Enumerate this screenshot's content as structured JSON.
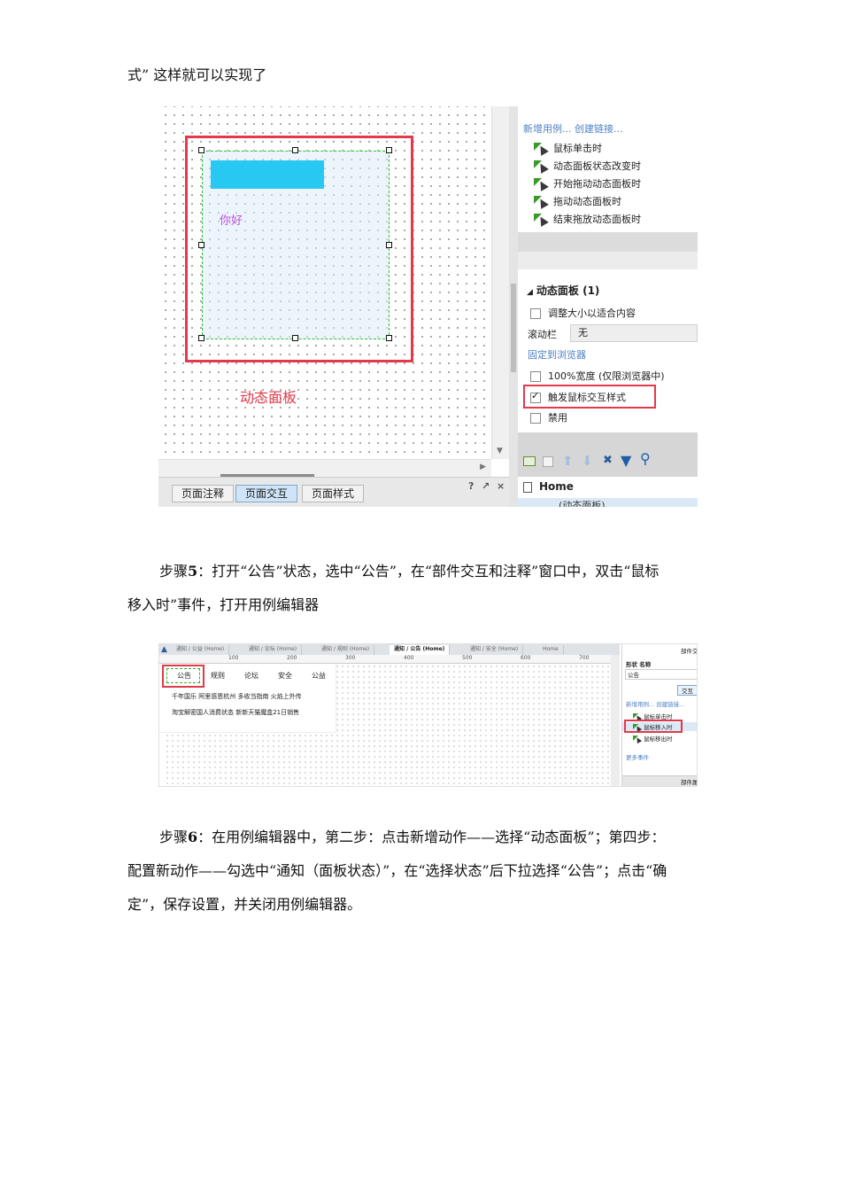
{
  "top_line": "式” 这样就可以实现了",
  "figure1": {
    "canvas_label": "动态面板",
    "canvas_text": "你好",
    "bottom_tabs": [
      "页面注释",
      "页面交互",
      "页面样式"
    ],
    "bottom_tools": [
      "?",
      "↗",
      "×"
    ],
    "panel": {
      "links": "新增用例... 创建链接...",
      "events": [
        "鼠标单击时",
        "动态面板状态改变时",
        "开始拖动动态面板时",
        "拖动动态面板时",
        "结束拖放动态面板时"
      ],
      "section_title": "动态面板 (1)",
      "fit_content": "调整大小以适合内容",
      "scrollbar_label": "滚动栏",
      "scrollbar_value": "无",
      "pin_link": "固定到浏览器",
      "full_width": "100%宽度 (仅限浏览器中)",
      "trigger_mouse": "触发鼠标交互样式",
      "disable": "禁用",
      "tree_home": "Home",
      "tree_child": "(动态面板)"
    }
  },
  "step5": {
    "label": "步骤",
    "num": "5",
    "text_a": "：打开“公告”状态，选中“公告”，在“部件交互和注释”窗口中，双击“鼠标",
    "text_b": "移入时”事件，打开用例编辑器"
  },
  "figure2": {
    "tabs": [
      "通知 / 公益 (Home)",
      "通知 / 论坛 (Home)",
      "通知 / 规则 (Home)",
      "通知 / 公告 (Home)",
      "通知 / 安全 (Home)",
      "Home"
    ],
    "ruler": [
      "100",
      "200",
      "300",
      "400",
      "500",
      "600",
      "700"
    ],
    "menu": [
      "公告",
      "规则",
      "论坛",
      "安全",
      "公益"
    ],
    "news1": "千年国乐  阿里感恩杭州  多收当指南  火焰上外传",
    "news2": "淘宝解密国人消费状态    新新天猫魔盒21日销售",
    "panel": {
      "title": "部件交",
      "col_header": "形状 名称",
      "name_value": "公告",
      "tab": "交互",
      "links": "新增用例... 创建链接...",
      "events": [
        "鼠标单击时",
        "鼠标移入时",
        "鼠标移出时"
      ],
      "more": "更多事件",
      "footer": "部件属"
    }
  },
  "step6": {
    "label": "步骤",
    "num": "6",
    "line1": "：在用例编辑器中，第二步：点击新增动作——选择“动态面板”；第四步：",
    "line2": "配置新动作——勾选中“通知（面板状态）”，在“选择状态”后下拉选择“公告”；点击“确",
    "line3": "定”，保存设置，并关闭用例编辑器。"
  },
  "colors": {
    "highlight_red": "#e23a4a",
    "cyan": "#27c8f2",
    "link_blue": "#4d7fc4",
    "selection_green": "#2fbf2f"
  }
}
